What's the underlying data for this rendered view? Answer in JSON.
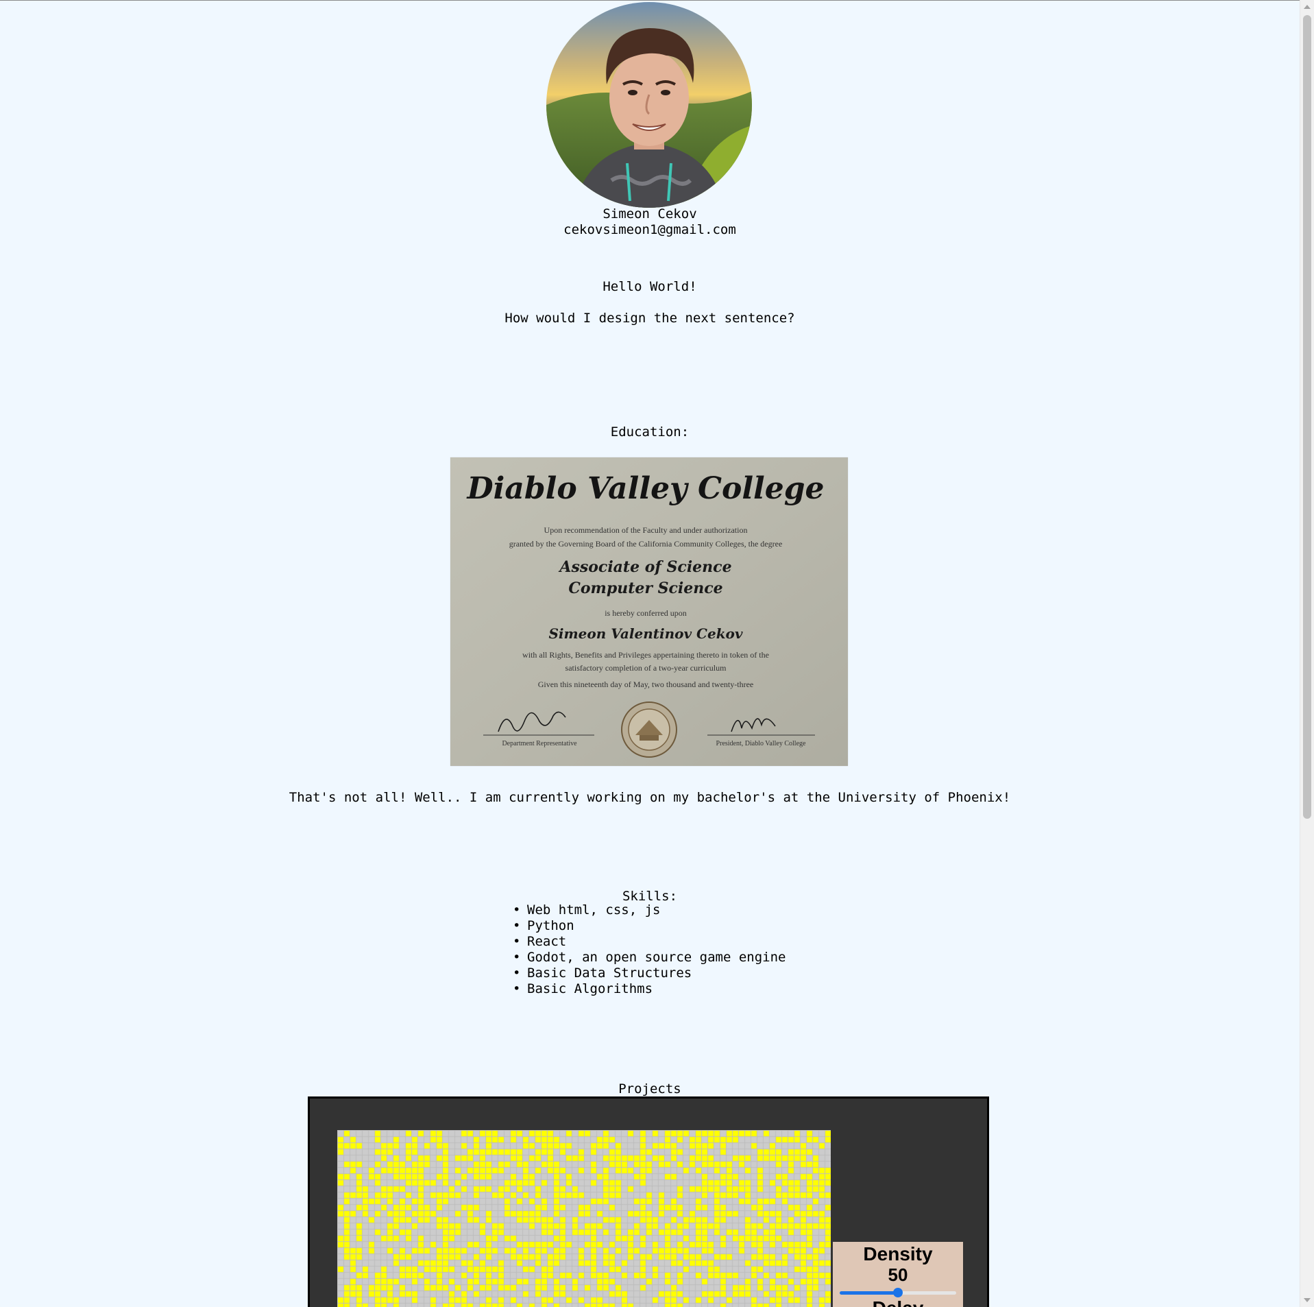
{
  "profile": {
    "name": "Simeon Cekov",
    "email": "cekovsimeon1@gmail.com"
  },
  "intro": {
    "greeting": "Hello World!",
    "question": "How would I design the next sentence?"
  },
  "education": {
    "heading": "Education:",
    "diploma": {
      "college": "Diablo Valley College",
      "recommendation_line1": "Upon recommendation of the Faculty and under authorization",
      "recommendation_line2": "granted by the Governing Board of the California Community Colleges, the degree",
      "degree_line1": "Associate of Science",
      "degree_line2": "Computer Science",
      "conferred": "is hereby conferred upon",
      "recipient": "Simeon Valentinov Cekov",
      "rights_line1": "with all Rights, Benefits and Privileges appertaining thereto in token of the",
      "rights_line2": "satisfactory completion of a two-year curriculum",
      "given": "Given this nineteenth day of May, two thousand and twenty-three",
      "sig_left_title": "Department Representative",
      "sig_right_title": "President, Diablo Valley College"
    },
    "note": "That's not all! Well.. I am currently working on my bachelor's at the University of Phoenix!"
  },
  "skills": {
    "heading": "Skills:",
    "items": [
      "Web html, css, js",
      "Python",
      "React",
      "Godot, an open source game engine",
      "Basic Data Structures",
      "Basic Algorithms"
    ]
  },
  "projects": {
    "heading": "Projects",
    "controls": {
      "density_label": "Density",
      "density_value": "50",
      "density_fraction": 0.5,
      "delay_label": "Delay"
    },
    "colors": {
      "cell_on": "#ffff00",
      "cell_off": "#cccccc",
      "slider_accent": "#1a73e8"
    }
  }
}
